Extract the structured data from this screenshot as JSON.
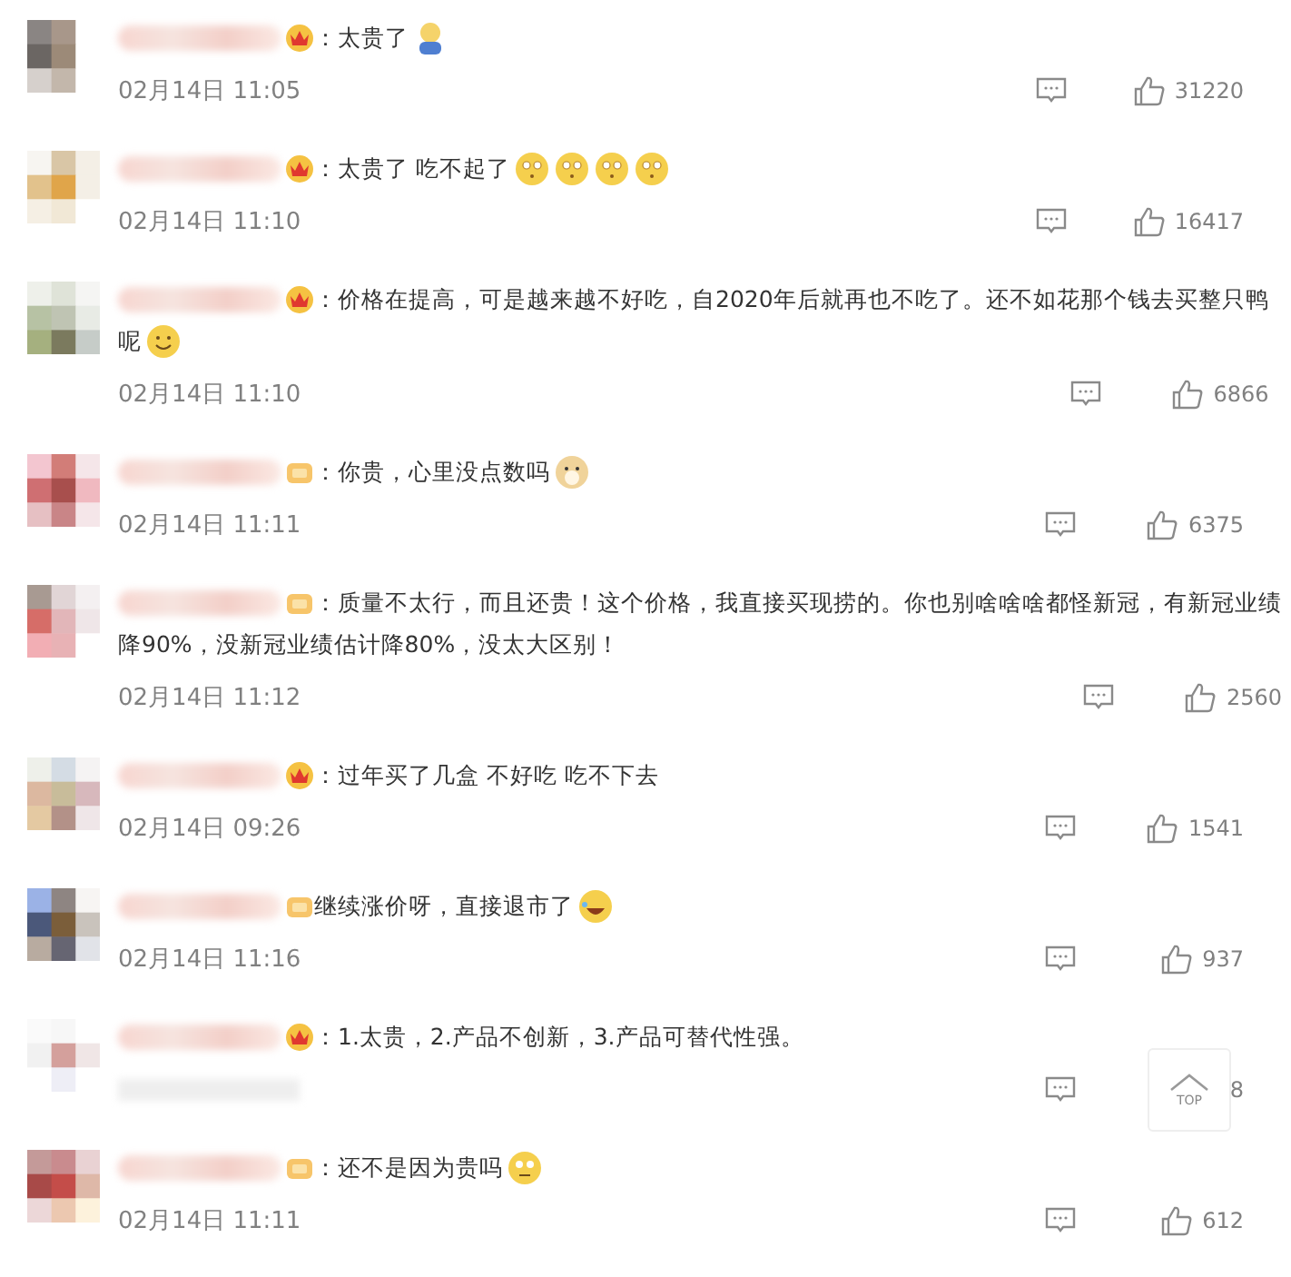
{
  "comments": [
    {
      "badge": {
        "kind": "crown"
      },
      "lines": [
        "：太贵了"
      ],
      "emojis": [
        {
          "kind": "figure"
        }
      ],
      "time": "02月14日 11:05",
      "likes": "31220"
    },
    {
      "badge": {
        "kind": "crown"
      },
      "lines": [
        "：太贵了 吃不起了"
      ],
      "emojis": [
        {
          "kind": "sleepy"
        },
        {
          "kind": "sleepy"
        },
        {
          "kind": "sleepy"
        },
        {
          "kind": "sleepy"
        }
      ],
      "time": "02月14日 11:10",
      "likes": "16417"
    },
    {
      "badge": {
        "kind": "crown"
      },
      "lines": [
        "：价格在提高，可是越来越不好吃，自2020年后就再也不吃了。还不如花那个钱去买整只鸭",
        "呢"
      ],
      "emojis": [
        {
          "kind": "smile"
        }
      ],
      "time": "02月14日 11:10",
      "likes": "6866"
    },
    {
      "badge": {
        "kind": "gold"
      },
      "lines": [
        "：你贵，心里没点数吗"
      ],
      "emojis": [
        {
          "kind": "dog"
        }
      ],
      "time": "02月14日 11:11",
      "likes": "6375"
    },
    {
      "badge": {
        "kind": "gold"
      },
      "lines": [
        "：质量不太行，而且还贵！这个价格，我直接买现捞的。你也别啥啥啥都怪新冠，有新冠业绩",
        "降90%，没新冠业绩估计降80%，没太大区别！"
      ],
      "time": "02月14日 11:12",
      "likes": "2560"
    },
    {
      "badge": {
        "kind": "crown"
      },
      "lines": [
        "：过年买了几盒 不好吃 吃不下去"
      ],
      "time": "02月14日 09:26",
      "likes": "1541"
    },
    {
      "badge": {
        "kind": "gold"
      },
      "lines": [
        "继续涨价呀，直接退市了"
      ],
      "emojis": [
        {
          "kind": "laugh"
        }
      ],
      "time": "02月14日 11:16",
      "likes": "937"
    },
    {
      "badge": {
        "kind": "crown"
      },
      "lines": [
        "：1.太贵，2.产品不创新，3.产品可替代性强。"
      ],
      "likes": "8",
      "likes_covered": true
    },
    {
      "badge": {
        "kind": "gold"
      },
      "lines": [
        "：还不是因为贵吗"
      ],
      "emojis": [
        {
          "kind": "roll"
        }
      ],
      "time": "02月14日 11:11",
      "likes": "612"
    }
  ],
  "top_button": {
    "label": "TOP"
  }
}
